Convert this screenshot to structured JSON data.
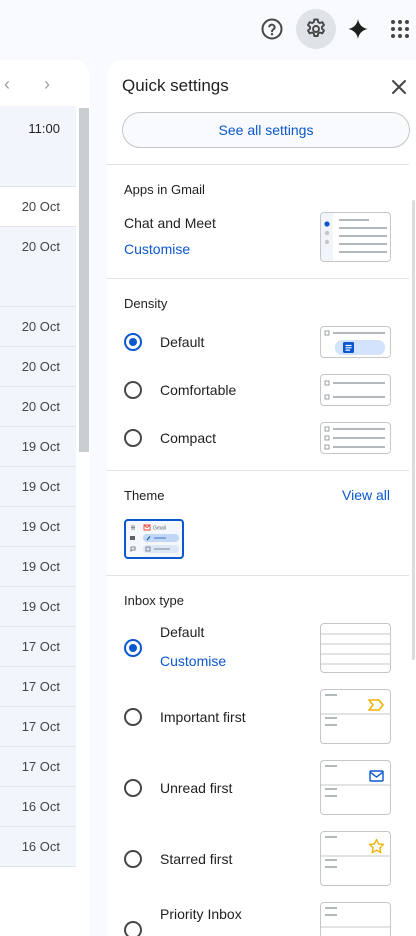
{
  "topbar": {
    "icons": [
      "help-icon",
      "settings-gear-icon",
      "gemini-sparkle-icon",
      "apps-grid-icon"
    ]
  },
  "mail_list": {
    "nav_prev": "‹",
    "nav_next": "›",
    "rows": [
      {
        "date": "11:00"
      },
      {
        "date": "20 Oct"
      },
      {
        "date": "20 Oct"
      },
      {
        "date": "20 Oct"
      },
      {
        "date": "20 Oct"
      },
      {
        "date": "20 Oct"
      },
      {
        "date": "19 Oct"
      },
      {
        "date": "19 Oct"
      },
      {
        "date": "19 Oct"
      },
      {
        "date": "19 Oct"
      },
      {
        "date": "19 Oct"
      },
      {
        "date": "17 Oct"
      },
      {
        "date": "17 Oct"
      },
      {
        "date": "17 Oct"
      },
      {
        "date": "17 Oct"
      },
      {
        "date": "16 Oct"
      },
      {
        "date": "16 Oct"
      }
    ]
  },
  "quick_settings": {
    "title": "Quick settings",
    "see_all_label": "See all settings",
    "apps": {
      "heading": "Apps in Gmail",
      "item": "Chat and Meet",
      "link": "Customise"
    },
    "density": {
      "heading": "Density",
      "options": [
        {
          "label": "Default",
          "selected": true
        },
        {
          "label": "Comfortable",
          "selected": false
        },
        {
          "label": "Compact",
          "selected": false
        }
      ]
    },
    "theme": {
      "heading": "Theme",
      "link": "View all",
      "thumb_label": "Gmail"
    },
    "inbox_type": {
      "heading": "Inbox type",
      "options": [
        {
          "label": "Default",
          "selected": true,
          "link": "Customise"
        },
        {
          "label": "Important first",
          "selected": false
        },
        {
          "label": "Unread first",
          "selected": false
        },
        {
          "label": "Starred first",
          "selected": false
        },
        {
          "label": "Priority Inbox",
          "selected": false
        }
      ]
    },
    "colors": {
      "accent": "#0b57d0",
      "important_marker": "#f2b400",
      "star": "#f2b400"
    }
  }
}
